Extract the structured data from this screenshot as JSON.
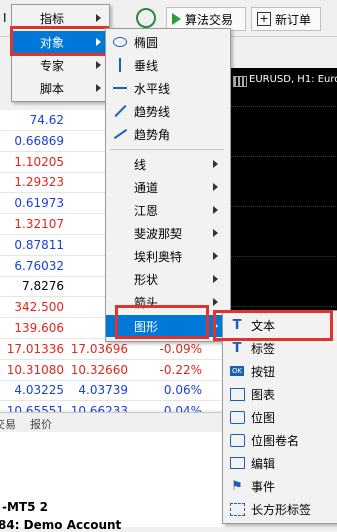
{
  "toolbar": {
    "algo_label": "算法交易",
    "neworder_label": "新订单",
    "left_cut": "I"
  },
  "chart": {
    "title": "EURUSD, H1: Euro"
  },
  "menu1": {
    "items": [
      {
        "label": "指标"
      },
      {
        "label": "对象"
      },
      {
        "label": "专家"
      },
      {
        "label": "脚本"
      }
    ]
  },
  "menu2": {
    "items": [
      {
        "label": "椭圆",
        "icon": "ellipse-icon"
      },
      {
        "label": "垂线",
        "icon": "vertical-line-icon"
      },
      {
        "label": "水平线",
        "icon": "horizontal-line-icon"
      },
      {
        "label": "趋势线",
        "icon": "trendline-icon"
      },
      {
        "label": "趋势角",
        "icon": "trend-angle-icon"
      },
      {
        "label": "线"
      },
      {
        "label": "通道"
      },
      {
        "label": "江恩"
      },
      {
        "label": "斐波那契"
      },
      {
        "label": "埃利奥特"
      },
      {
        "label": "形状"
      },
      {
        "label": "箭头"
      },
      {
        "label": "图形"
      }
    ]
  },
  "menu3": {
    "items": [
      {
        "label": "文本",
        "icon": "text-icon"
      },
      {
        "label": "标签",
        "icon": "label-icon"
      },
      {
        "label": "按钮",
        "icon": "button-icon"
      },
      {
        "label": "图表",
        "icon": "chart-icon"
      },
      {
        "label": "位图",
        "icon": "bitmap-icon"
      },
      {
        "label": "位图卷名",
        "icon": "bitmap-label-icon"
      },
      {
        "label": "编辑",
        "icon": "edit-icon"
      },
      {
        "label": "事件",
        "icon": "event-icon"
      },
      {
        "label": "长方形标签",
        "icon": "rectangle-label-icon"
      }
    ]
  },
  "quotes": {
    "rows": [
      {
        "bid": "74.62",
        "ask": "",
        "chg": "",
        "color": "blue"
      },
      {
        "bid": "0.66869",
        "ask": "0.6",
        "chg": "",
        "color": "blue"
      },
      {
        "bid": "1.10205",
        "ask": "1.1",
        "chg": "",
        "color": "red"
      },
      {
        "bid": "1.29323",
        "ask": "1.2",
        "chg": "",
        "color": "red"
      },
      {
        "bid": "0.61973",
        "ask": "0.6",
        "chg": "",
        "color": "blue"
      },
      {
        "bid": "1.32107",
        "ask": "1.3",
        "chg": "",
        "color": "red"
      },
      {
        "bid": "0.87811",
        "ask": "0.8",
        "chg": "",
        "color": "blue"
      },
      {
        "bid": "6.76032",
        "ask": "6.7",
        "chg": "",
        "color": "blue"
      },
      {
        "bid": "7.8276",
        "ask": "7.8",
        "chg": "",
        "color": "black"
      },
      {
        "bid": "342.500",
        "ask": "343",
        "chg": "",
        "color": "red"
      },
      {
        "bid": "139.606",
        "ask": "139",
        "chg": "",
        "color": "red"
      },
      {
        "bid": "17.01336",
        "ask": "17.03696",
        "chg": "-0.09%",
        "color": "red"
      },
      {
        "bid": "10.31080",
        "ask": "10.32660",
        "chg": "-0.22%",
        "color": "red"
      },
      {
        "bid": "4.03225",
        "ask": "4.03739",
        "chg": "0.06%",
        "color": "blue"
      },
      {
        "bid": "10.65551",
        "ask": "10.66233",
        "chg": "0.04%",
        "color": "blue"
      }
    ]
  },
  "bottom_tabs": [
    "交易",
    "报价"
  ],
  "account": {
    "line1": "-MT5 2",
    "line2": "84: Demo Account"
  }
}
